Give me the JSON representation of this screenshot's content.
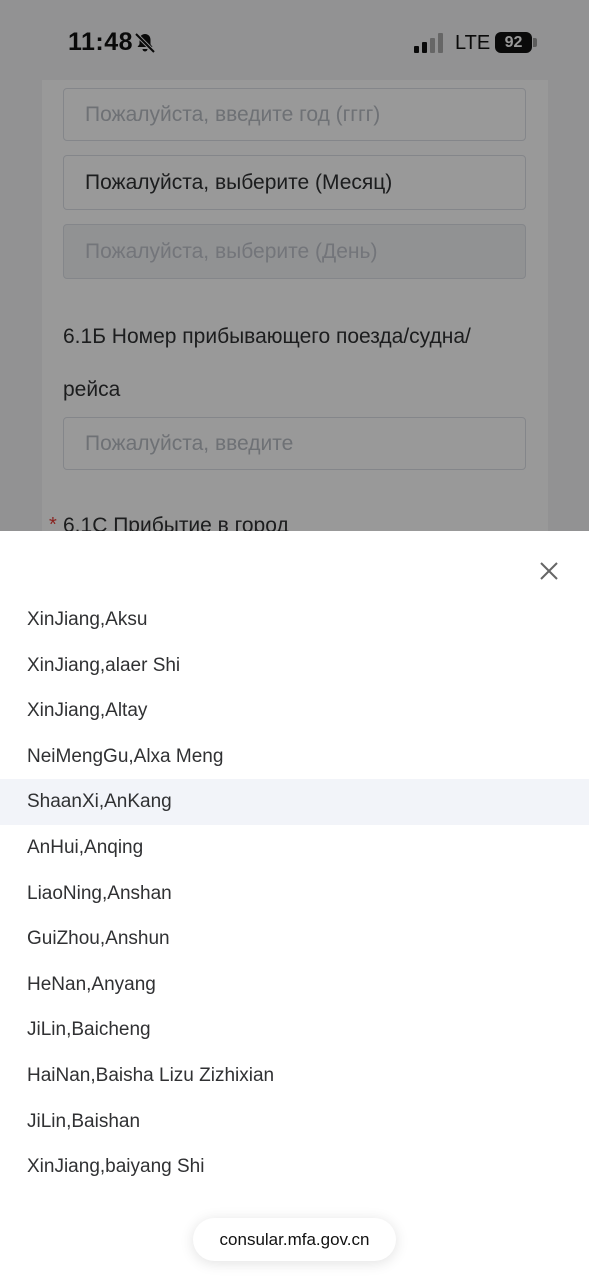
{
  "status_bar": {
    "time": "11:48",
    "network": "LTE",
    "battery": "92",
    "icons": [
      "bell-slash-icon",
      "signal-icon",
      "battery-icon"
    ]
  },
  "form": {
    "year_placeholder": "Пожалуйста, введите год (гггг)",
    "month_value": "Пожалуйста, выберите (Месяц)",
    "day_placeholder": "Пожалуйста, выберите (День)",
    "train_label_line1": "6.1Б Номер прибывающего поезда/судна/",
    "train_label_line2": "рейса",
    "train_placeholder": "Пожалуйста, введите",
    "required_mark": "*",
    "arrival_city_label": "6.1С Прибытие в город"
  },
  "picker": {
    "close_icon": "close-icon",
    "selected_index": 4,
    "options": [
      "XinJiang,Aksu",
      "XinJiang,alaer Shi",
      "XinJiang,Altay",
      "NeiMengGu,Alxa Meng",
      "ShaanXi,AnKang",
      "AnHui,Anqing",
      "LiaoNing,Anshan",
      "GuiZhou,Anshun",
      "HeNan,Anyang",
      "JiLin,Baicheng",
      "HaiNan,Baisha Lizu Zizhixian",
      "JiLin,Baishan",
      "XinJiang,baiyang Shi"
    ]
  },
  "browser": {
    "url": "consular.mfa.gov.cn"
  }
}
